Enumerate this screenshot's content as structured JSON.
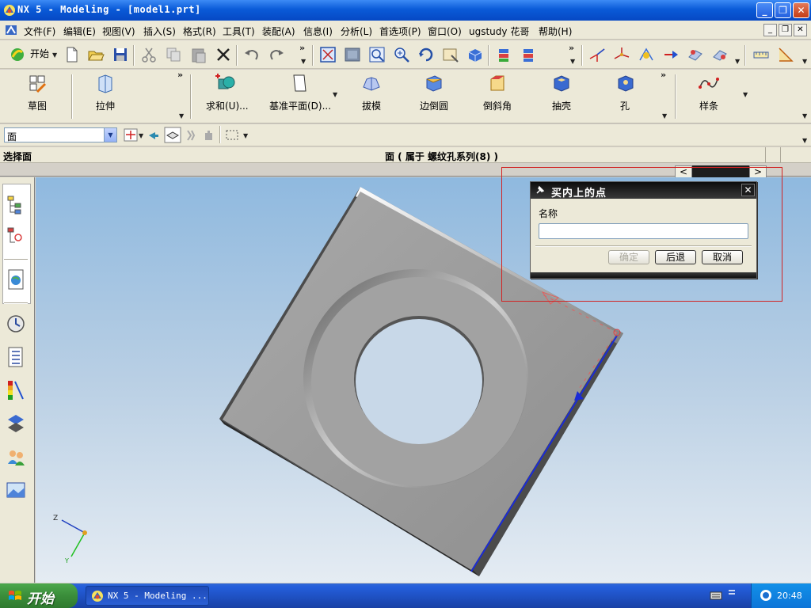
{
  "window": {
    "title": "NX 5 - Modeling - [model1.prt]",
    "controls": [
      "_",
      "❐",
      "✕"
    ]
  },
  "menubar": {
    "items": [
      "文件(F)",
      "编辑(E)",
      "视图(V)",
      "插入(S)",
      "格式(R)",
      "工具(T)",
      "装配(A)",
      "信息(I)",
      "分析(L)",
      "首选项(P)",
      "窗口(O)",
      "ugstudy 花哥",
      "帮助(H)"
    ],
    "mdi_controls": [
      "_",
      "❐",
      "✕"
    ]
  },
  "toolbar": {
    "start_label": "开始",
    "overflow": "»",
    "icons": [
      "new-icon",
      "open-icon",
      "save-icon",
      "cut-icon",
      "copy-icon",
      "paste-icon",
      "delete-icon",
      "undo-icon",
      "redo-icon",
      "fit-icon",
      "zoom-window-icon",
      "zoom-icon",
      "pan-icon",
      "rotate-icon",
      "shaded-icon",
      "wcs-icon",
      "point-icon",
      "measure-icon"
    ]
  },
  "features": {
    "items": [
      {
        "label": "草图",
        "icon": "sketch-icon"
      },
      {
        "label": "拉伸",
        "icon": "extrude-icon"
      },
      {
        "label": "求和(U)...",
        "icon": "unite-icon"
      },
      {
        "label": "基准平面(D)...",
        "icon": "datum-plane-icon"
      },
      {
        "label": "拔模",
        "icon": "draft-icon"
      },
      {
        "label": "边倒圆",
        "icon": "edge-blend-icon"
      },
      {
        "label": "倒斜角",
        "icon": "chamfer-icon"
      },
      {
        "label": "抽壳",
        "icon": "shell-icon"
      },
      {
        "label": "孔",
        "icon": "hole-icon"
      },
      {
        "label": "样条",
        "icon": "spline-icon"
      }
    ]
  },
  "selection": {
    "filter_value": "面"
  },
  "status": {
    "prompt": "选择面",
    "info": "面 ( 属于 螺纹孔系列(8) )"
  },
  "graphics": {
    "triad": {
      "z": "Z",
      "y": "Y"
    }
  },
  "dialog": {
    "title": "买内上的点",
    "name_label": "名称",
    "name_value": "",
    "ok": "确定",
    "back": "后退",
    "cancel": "取消",
    "close": "✕"
  },
  "resource_bar": {
    "icons": [
      "assembly-navigator-icon",
      "constraint-navigator-icon",
      "web-browser-icon",
      "history-icon",
      "part-navigator-icon",
      "palette-icon",
      "process-icon",
      "roles-icon",
      "system-scene-icon"
    ]
  },
  "taskbar": {
    "start_label": "开始",
    "task_title": "NX 5 - Modeling ...",
    "clock": "20:48"
  },
  "colors": {
    "selection_rect": "#d12424",
    "dialog_title": "#111111",
    "highlight_edge": "#1a2bd6"
  }
}
